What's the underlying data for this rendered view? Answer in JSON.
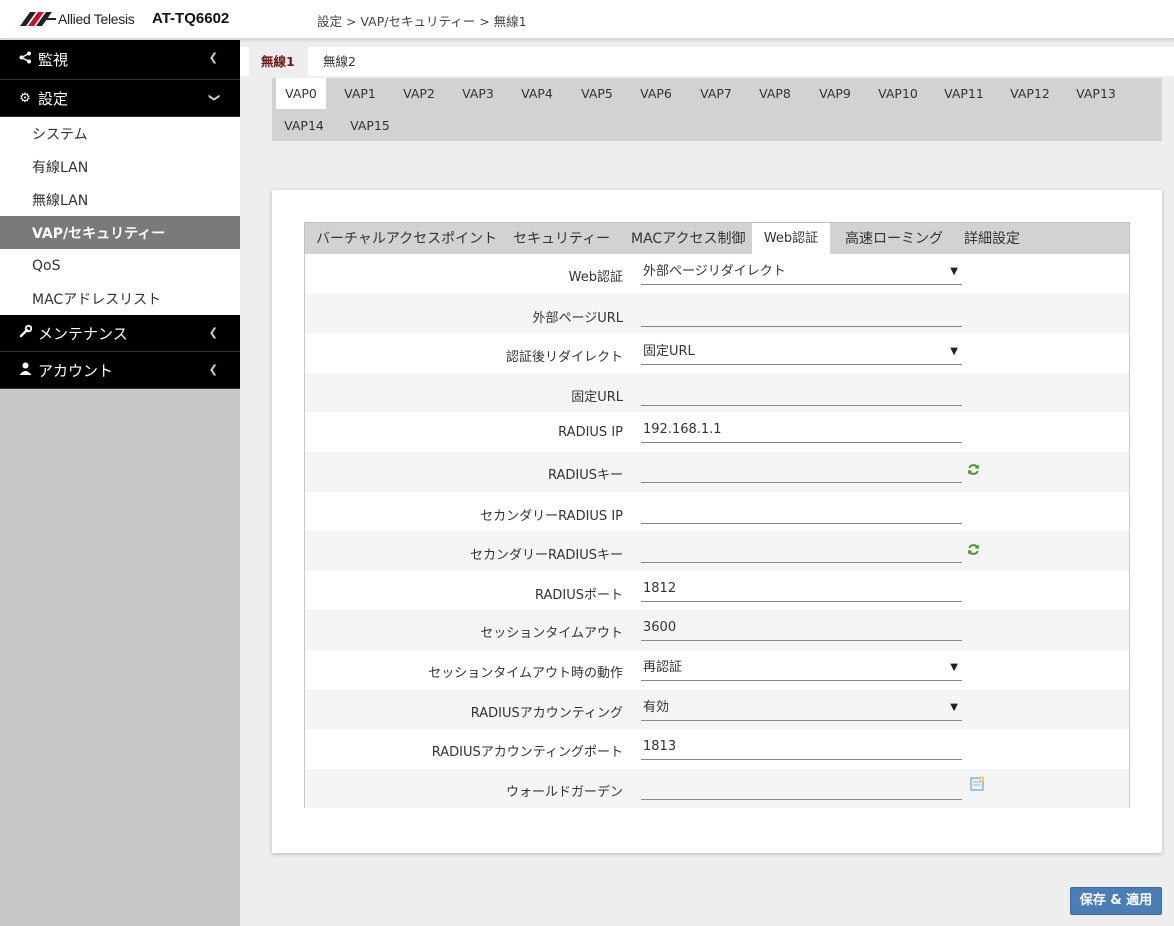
{
  "header": {
    "brand": "Allied Telesis",
    "model": "AT-TQ6602",
    "breadcrumb": "設定 > VAP/セキュリティー > 無線1"
  },
  "sidebar": {
    "monitor": "監視",
    "settings": "設定",
    "sub_items": [
      "システム",
      "有線LAN",
      "無線LAN",
      "VAP/セキュリティー",
      "QoS",
      "MACアドレスリスト"
    ],
    "maintenance": "メンテナンス",
    "account": "アカウント"
  },
  "radio_tabs": [
    "無線1",
    "無線2"
  ],
  "vap_tabs": [
    "VAP0",
    "VAP1",
    "VAP2",
    "VAP3",
    "VAP4",
    "VAP5",
    "VAP6",
    "VAP7",
    "VAP8",
    "VAP9",
    "VAP10",
    "VAP11",
    "VAP12",
    "VAP13",
    "VAP14",
    "VAP15"
  ],
  "sub_tabs": [
    "バーチャルアクセスポイント",
    "セキュリティー",
    "MACアクセス制御",
    "Web認証",
    "高速ローミング",
    "詳細設定"
  ],
  "form": {
    "rows": [
      {
        "label": "Web認証",
        "value": "外部ページリダイレクト"
      },
      {
        "label": "外部ページURL",
        "value": ""
      },
      {
        "label": "認証後リダイレクト",
        "value": "固定URL"
      },
      {
        "label": "固定URL",
        "value": ""
      },
      {
        "label": "RADIUS IP",
        "value": "192.168.1.1"
      },
      {
        "label": "RADIUSキー",
        "value": ""
      },
      {
        "label": "セカンダリーRADIUS IP",
        "value": ""
      },
      {
        "label": "セカンダリーRADIUSキー",
        "value": ""
      },
      {
        "label": "RADIUSポート",
        "value": "1812"
      },
      {
        "label": "セッションタイムアウト",
        "value": "3600"
      },
      {
        "label": "セッションタイムアウト時の動作",
        "value": "再認証"
      },
      {
        "label": "RADIUSアカウンティング",
        "value": "有効"
      },
      {
        "label": "RADIUSアカウンティングポート",
        "value": "1813"
      },
      {
        "label": "ウォールドガーデン",
        "value": ""
      }
    ]
  },
  "save_label": "保存 & 適用",
  "colors": {
    "accent": "#4a7eb7",
    "active_radio": "#6a1a1a",
    "sidebar_active": "#7a7a7a"
  }
}
